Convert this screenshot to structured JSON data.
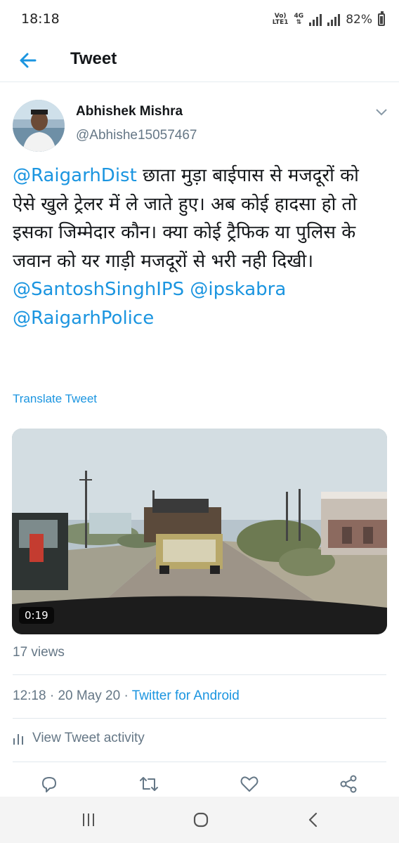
{
  "status_bar": {
    "time": "18:18",
    "network_top": "Vo)",
    "network_sub": "LTE1",
    "network_type": "4G",
    "battery": "82%"
  },
  "app_bar": {
    "title": "Tweet",
    "back_icon": "arrow-left-icon"
  },
  "tweet": {
    "author_name": "Abhishek Mishra",
    "author_handle": "@Abhishe15057467",
    "text_parts": [
      {
        "text": "@RaigarhDist",
        "type": "mention"
      },
      {
        "text": "  छाता मुड़ा बाईपास से मजदूरों को ऐसे खुले ट्रेलर में ले जाते हुए। अब कोई हादसा हो तो इसका जिम्मेदार कौन। क्या कोई ट्रैफिक या पुलिस के जवान को यर गाड़ी मजदूरों से भरी नही दिखी। ",
        "type": "text"
      },
      {
        "text": "@SantoshSinghIPS",
        "type": "mention"
      },
      {
        "text": " ",
        "type": "text"
      },
      {
        "text": "@ipskabra",
        "type": "mention"
      },
      {
        "text": " ",
        "type": "text"
      },
      {
        "text": "@RaigarhPolice",
        "type": "mention"
      }
    ],
    "translate_label": "Translate Tweet",
    "video_duration": "0:19",
    "views": "17 views",
    "time": "12:18",
    "separator": "·",
    "date": "20 May 20",
    "client": "Twitter for Android",
    "activity_label": "View Tweet activity"
  },
  "actions": [
    "reply-icon",
    "retweet-icon",
    "like-icon",
    "share-icon"
  ],
  "nav_bar": [
    "recent-apps-icon",
    "home-icon",
    "back-icon"
  ],
  "colors": {
    "link": "#1b95e0",
    "secondary": "#657786",
    "divider": "#e1e8ed"
  }
}
